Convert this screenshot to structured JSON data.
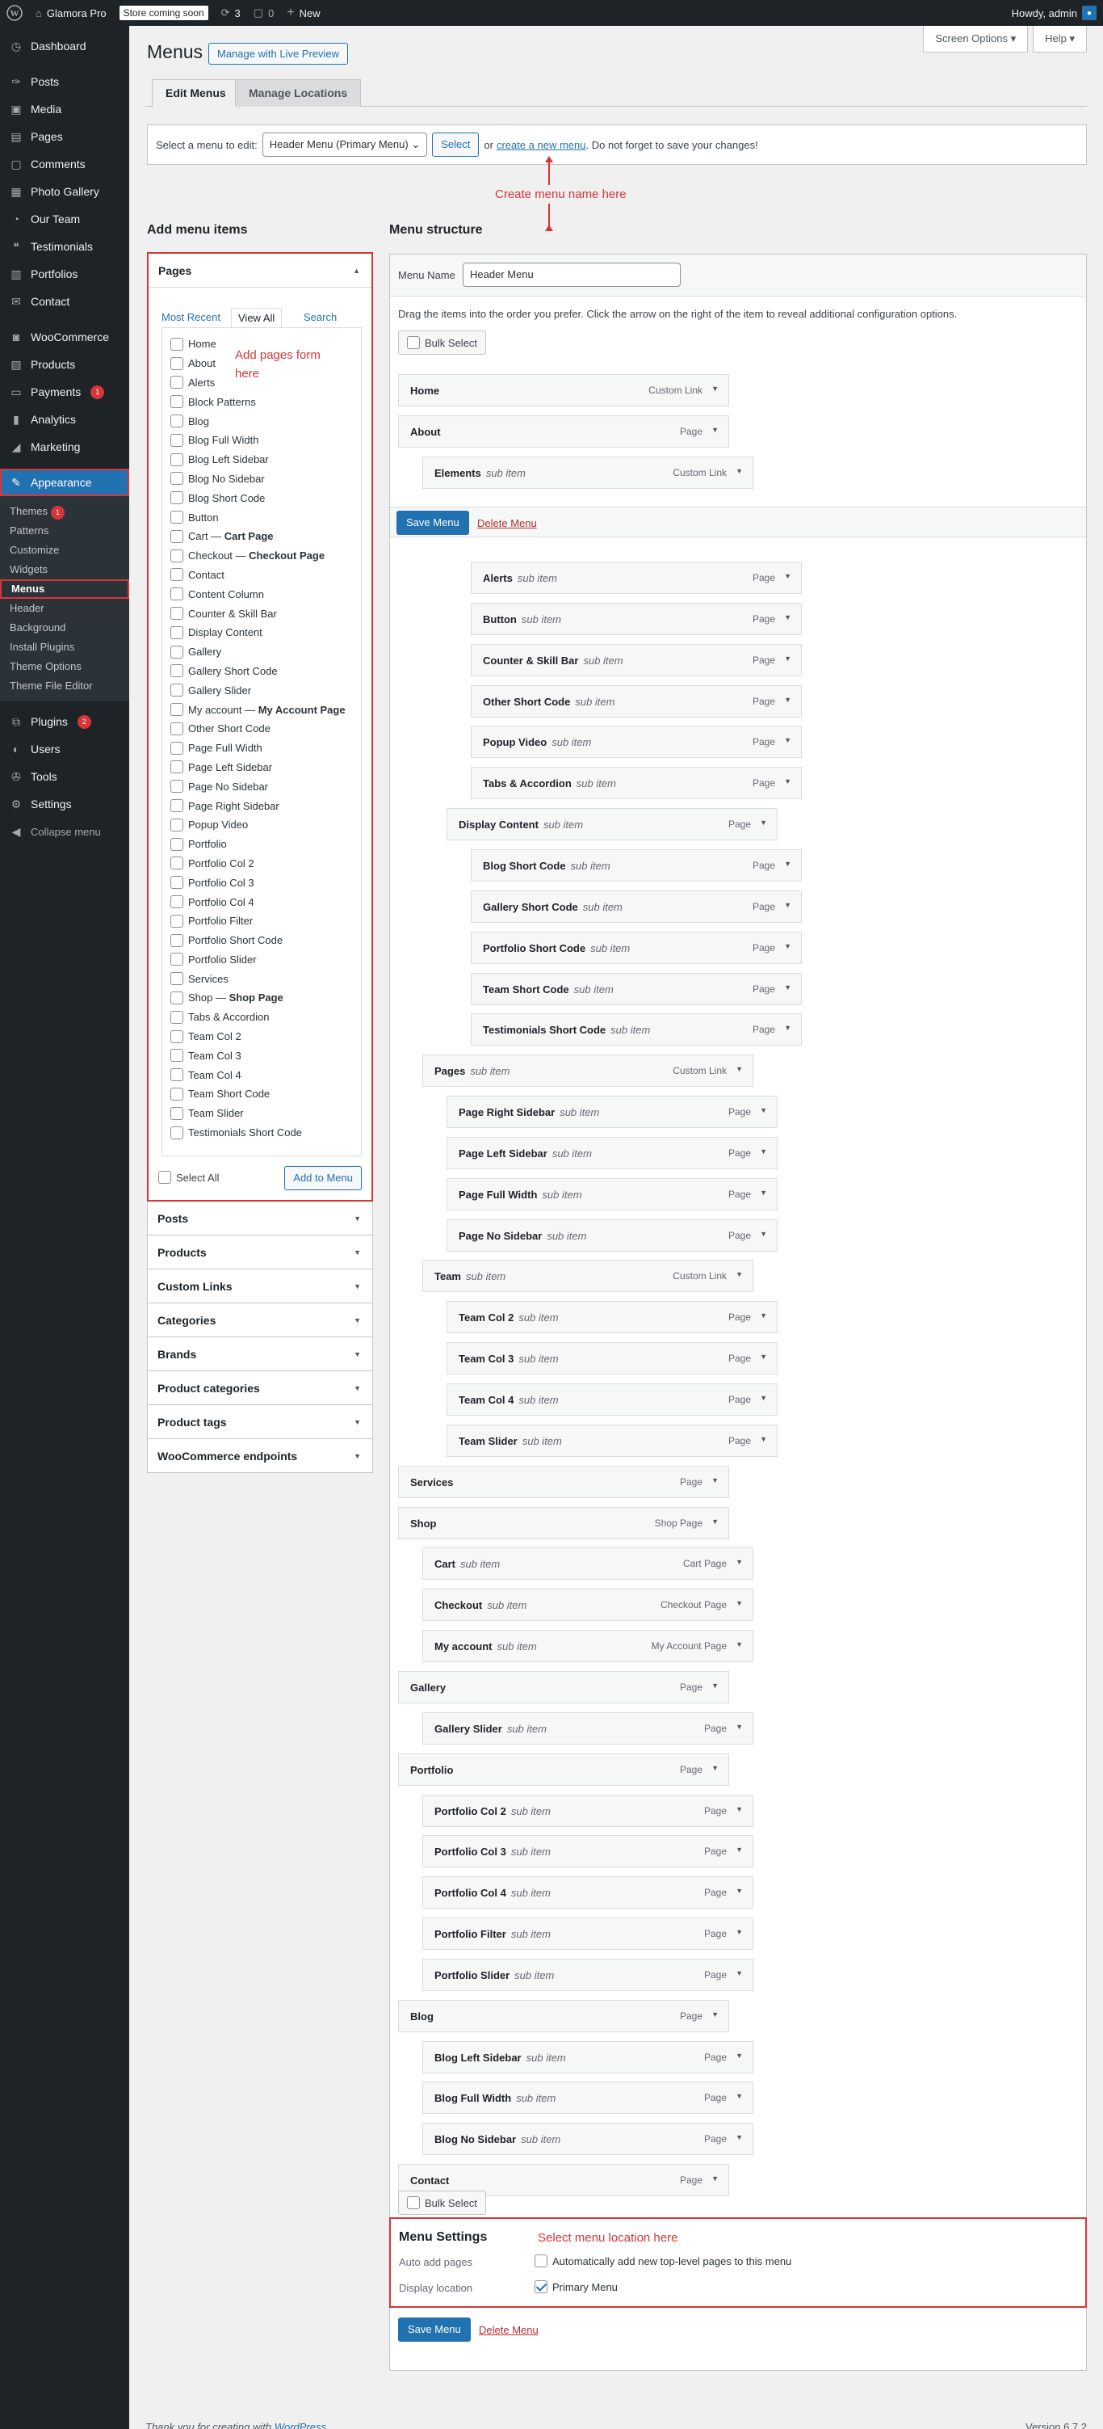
{
  "adminbar": {
    "site_name": "Glamora Pro",
    "coming_soon": "Store coming soon",
    "updates_count": "3",
    "comments_count": "0",
    "new_label": "New",
    "howdy": "Howdy, admin"
  },
  "sidebar": {
    "items": [
      {
        "label": "Dashboard",
        "icon": "dashboard-icon"
      },
      {
        "label": "Posts",
        "icon": "pin-icon"
      },
      {
        "label": "Media",
        "icon": "media-icon"
      },
      {
        "label": "Pages",
        "icon": "page-icon"
      },
      {
        "label": "Comments",
        "icon": "comment-icon"
      },
      {
        "label": "Photo Gallery",
        "icon": "gallery-icon"
      },
      {
        "label": "Our Team",
        "icon": "team-icon"
      },
      {
        "label": "Testimonials",
        "icon": "quote-icon"
      },
      {
        "label": "Portfolios",
        "icon": "portfolio-icon"
      },
      {
        "label": "Contact",
        "icon": "mail-icon"
      },
      {
        "label": "WooCommerce",
        "icon": "woo-icon"
      },
      {
        "label": "Products",
        "icon": "archive-icon"
      },
      {
        "label": "Payments",
        "icon": "card-icon",
        "badge": "1"
      },
      {
        "label": "Analytics",
        "icon": "chart-icon"
      },
      {
        "label": "Marketing",
        "icon": "megaphone-icon"
      }
    ],
    "appearance": "Appearance",
    "appearance_sub": [
      {
        "label": "Themes",
        "badge": "1"
      },
      {
        "label": "Patterns"
      },
      {
        "label": "Customize"
      },
      {
        "label": "Widgets"
      },
      {
        "label": "Menus"
      },
      {
        "label": "Header"
      },
      {
        "label": "Background"
      },
      {
        "label": "Install Plugins"
      },
      {
        "label": "Theme Options"
      },
      {
        "label": "Theme File Editor"
      }
    ],
    "bottom": [
      {
        "label": "Plugins",
        "badge": "2"
      },
      {
        "label": "Users"
      },
      {
        "label": "Tools"
      },
      {
        "label": "Settings"
      }
    ],
    "collapse": "Collapse menu"
  },
  "header": {
    "screen_options": "Screen Options ▾",
    "help": "Help ▾",
    "title": "Menus",
    "live_preview": "Manage with Live Preview",
    "tab_edit": "Edit Menus",
    "tab_locations": "Manage Locations"
  },
  "select_bar": {
    "label": "Select a menu to edit:",
    "selected": "Header Menu (Primary Menu)",
    "select_btn": "Select",
    "or": "or",
    "create_link": "create a new menu",
    "suffix": ". Do not forget to save your changes!"
  },
  "annotations": {
    "create_name": "Create menu name here",
    "add_pages": "Add pages form here",
    "location": "Select menu location here",
    "color": "#d63638"
  },
  "add_items": {
    "title": "Add menu items",
    "pages_title": "Pages",
    "tab_recent": "Most Recent",
    "tab_all": "View All",
    "tab_search": "Search",
    "pages": [
      "Home",
      "About",
      "Alerts",
      "Block Patterns",
      "Blog",
      "Blog Full Width",
      "Blog Left Sidebar",
      "Blog No Sidebar",
      "Blog Short Code",
      "Button",
      "Cart — Cart Page",
      "Checkout — Checkout Page",
      "Contact",
      "Content Column",
      "Counter & Skill Bar",
      "Display Content",
      "Gallery",
      "Gallery Short Code",
      "Gallery Slider",
      "My account — My Account Page",
      "Other Short Code",
      "Page Full Width",
      "Page Left Sidebar",
      "Page No Sidebar",
      "Page Right Sidebar",
      "Popup Video",
      "Portfolio",
      "Portfolio Col 2",
      "Portfolio Col 3",
      "Portfolio Col 4",
      "Portfolio Filter",
      "Portfolio Short Code",
      "Portfolio Slider",
      "Services",
      "Shop — Shop Page",
      "Tabs & Accordion",
      "Team Col 2",
      "Team Col 3",
      "Team Col 4",
      "Team Short Code",
      "Team Slider",
      "Testimonials Short Code"
    ],
    "select_all": "Select All",
    "add_btn": "Add to Menu",
    "others": [
      "Posts",
      "Products",
      "Custom Links",
      "Categories",
      "Brands",
      "Product categories",
      "Product tags",
      "WooCommerce endpoints"
    ]
  },
  "structure": {
    "title": "Menu structure",
    "name_label": "Menu Name",
    "name_value": "Header Menu",
    "hint": "Drag the items into the order you prefer. Click the arrow on the right of the item to reveal additional configuration options.",
    "bulk_select": "Bulk Select",
    "save": "Save Menu",
    "delete": "Delete Menu",
    "items": [
      {
        "t": "Home",
        "sub": "",
        "k": "Custom Link",
        "d": 0
      },
      {
        "t": "About",
        "sub": "",
        "k": "Page",
        "d": 0
      },
      {
        "t": "Elements",
        "sub": "sub item",
        "k": "Custom Link",
        "d": 1
      },
      {
        "t": "Alerts",
        "sub": "sub item",
        "k": "Page",
        "d": 3
      },
      {
        "t": "Button",
        "sub": "sub item",
        "k": "Page",
        "d": 3
      },
      {
        "t": "Counter & Skill Bar",
        "sub": "sub item",
        "k": "Page",
        "d": 3
      },
      {
        "t": "Other Short Code",
        "sub": "sub item",
        "k": "Page",
        "d": 3
      },
      {
        "t": "Popup Video",
        "sub": "sub item",
        "k": "Page",
        "d": 3
      },
      {
        "t": "Tabs & Accordion",
        "sub": "sub item",
        "k": "Page",
        "d": 3
      },
      {
        "t": "Display Content",
        "sub": "sub item",
        "k": "Page",
        "d": 2
      },
      {
        "t": "Blog Short Code",
        "sub": "sub item",
        "k": "Page",
        "d": 3
      },
      {
        "t": "Gallery Short Code",
        "sub": "sub item",
        "k": "Page",
        "d": 3
      },
      {
        "t": "Portfolio Short Code",
        "sub": "sub item",
        "k": "Page",
        "d": 3
      },
      {
        "t": "Team Short Code",
        "sub": "sub item",
        "k": "Page",
        "d": 3
      },
      {
        "t": "Testimonials Short Code",
        "sub": "sub item",
        "k": "Page",
        "d": 3
      },
      {
        "t": "Pages",
        "sub": "sub item",
        "k": "Custom Link",
        "d": 1
      },
      {
        "t": "Page Right Sidebar",
        "sub": "sub item",
        "k": "Page",
        "d": 2
      },
      {
        "t": "Page Left Sidebar",
        "sub": "sub item",
        "k": "Page",
        "d": 2
      },
      {
        "t": "Page Full Width",
        "sub": "sub item",
        "k": "Page",
        "d": 2
      },
      {
        "t": "Page No Sidebar",
        "sub": "sub item",
        "k": "Page",
        "d": 2
      },
      {
        "t": "Team",
        "sub": "sub item",
        "k": "Custom Link",
        "d": 1
      },
      {
        "t": "Team Col 2",
        "sub": "sub item",
        "k": "Page",
        "d": 2
      },
      {
        "t": "Team Col 3",
        "sub": "sub item",
        "k": "Page",
        "d": 2
      },
      {
        "t": "Team Col 4",
        "sub": "sub item",
        "k": "Page",
        "d": 2
      },
      {
        "t": "Team Slider",
        "sub": "sub item",
        "k": "Page",
        "d": 2
      },
      {
        "t": "Services",
        "sub": "",
        "k": "Page",
        "d": 0
      },
      {
        "t": "Shop",
        "sub": "",
        "k": "Shop Page",
        "d": 0
      },
      {
        "t": "Cart",
        "sub": "sub item",
        "k": "Cart Page",
        "d": 1
      },
      {
        "t": "Checkout",
        "sub": "sub item",
        "k": "Checkout Page",
        "d": 1
      },
      {
        "t": "My account",
        "sub": "sub item",
        "k": "My Account Page",
        "d": 1
      },
      {
        "t": "Gallery",
        "sub": "",
        "k": "Page",
        "d": 0
      },
      {
        "t": "Gallery Slider",
        "sub": "sub item",
        "k": "Page",
        "d": 1
      },
      {
        "t": "Portfolio",
        "sub": "",
        "k": "Page",
        "d": 0
      },
      {
        "t": "Portfolio Col 2",
        "sub": "sub item",
        "k": "Page",
        "d": 1
      },
      {
        "t": "Portfolio Col 3",
        "sub": "sub item",
        "k": "Page",
        "d": 1
      },
      {
        "t": "Portfolio Col 4",
        "sub": "sub item",
        "k": "Page",
        "d": 1
      },
      {
        "t": "Portfolio Filter",
        "sub": "sub item",
        "k": "Page",
        "d": 1
      },
      {
        "t": "Portfolio Slider",
        "sub": "sub item",
        "k": "Page",
        "d": 1
      },
      {
        "t": "Blog",
        "sub": "",
        "k": "Page",
        "d": 0
      },
      {
        "t": "Blog Left Sidebar",
        "sub": "sub item",
        "k": "Page",
        "d": 1
      },
      {
        "t": "Blog Full Width",
        "sub": "sub item",
        "k": "Page",
        "d": 1
      },
      {
        "t": "Blog No Sidebar",
        "sub": "sub item",
        "k": "Page",
        "d": 1
      },
      {
        "t": "Contact",
        "sub": "",
        "k": "Page",
        "d": 0
      }
    ]
  },
  "settings": {
    "title": "Menu Settings",
    "auto_label": "Auto add pages",
    "auto_option": "Automatically add new top-level pages to this menu",
    "location_label": "Display location",
    "location_option": "Primary Menu"
  },
  "footer": {
    "thanks": "Thank you for creating with",
    "wp": "WordPress",
    "dot": ".",
    "version": "Version 6.7.2"
  }
}
